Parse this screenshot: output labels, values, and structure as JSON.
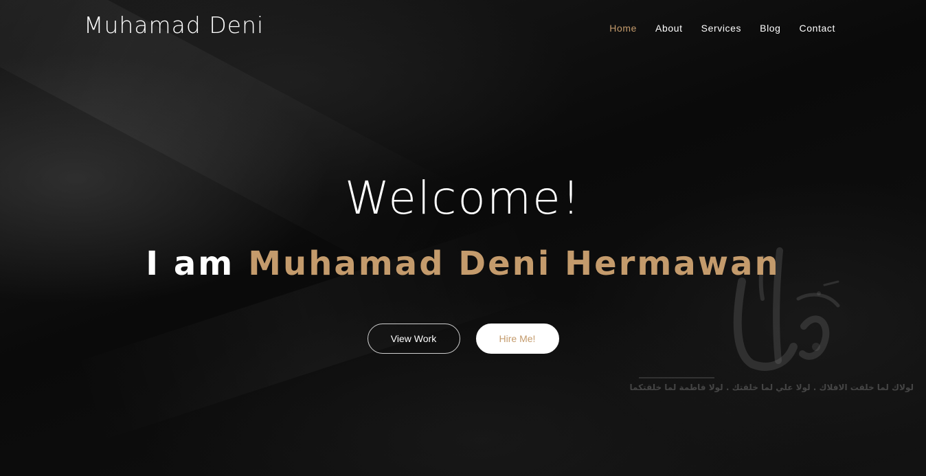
{
  "brand": {
    "name": "Muhamad Deni"
  },
  "nav": {
    "items": [
      {
        "label": "Home",
        "active": true
      },
      {
        "label": "About",
        "active": false
      },
      {
        "label": "Services",
        "active": false
      },
      {
        "label": "Blog",
        "active": false
      },
      {
        "label": "Contact",
        "active": false
      }
    ]
  },
  "hero": {
    "welcome": "Welcome!",
    "intro_lead": "I am",
    "intro_name": "Muhamad Deni Hermawan",
    "buttons": {
      "view_work": "View Work",
      "hire_me": "Hire Me!"
    }
  },
  "background_art": {
    "inscription": "لولاك لما خلقت الافلاك . لولا علي لما خلقتك . لولا فاطمة لما خلقتكما",
    "icon": "arabic-calligraphy-watermark"
  },
  "colors": {
    "accent": "#c49b6c",
    "background": "#0b0b0b",
    "text": "#ffffff"
  }
}
